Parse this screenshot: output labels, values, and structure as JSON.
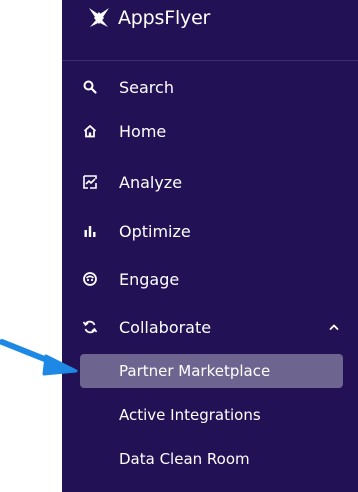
{
  "brand": {
    "name": "AppsFlyer"
  },
  "nav": {
    "search": {
      "label": "Search",
      "icon": "search-icon"
    },
    "home": {
      "label": "Home",
      "icon": "home-icon"
    },
    "analyze": {
      "label": "Analyze",
      "icon": "analyze-icon"
    },
    "optimize": {
      "label": "Optimize",
      "icon": "optimize-icon"
    },
    "engage": {
      "label": "Engage",
      "icon": "engage-icon"
    },
    "collaborate": {
      "label": "Collaborate",
      "icon": "collaborate-icon",
      "expanded": true,
      "children": [
        {
          "label": "Partner Marketplace",
          "active": true
        },
        {
          "label": "Active Integrations",
          "active": false
        },
        {
          "label": "Data Clean Room",
          "active": false
        }
      ]
    }
  },
  "colors": {
    "sidebar_bg": "#221155",
    "active_bg": "#6e6490",
    "text": "#ffffff",
    "annotation_arrow": "#1e88e5"
  }
}
